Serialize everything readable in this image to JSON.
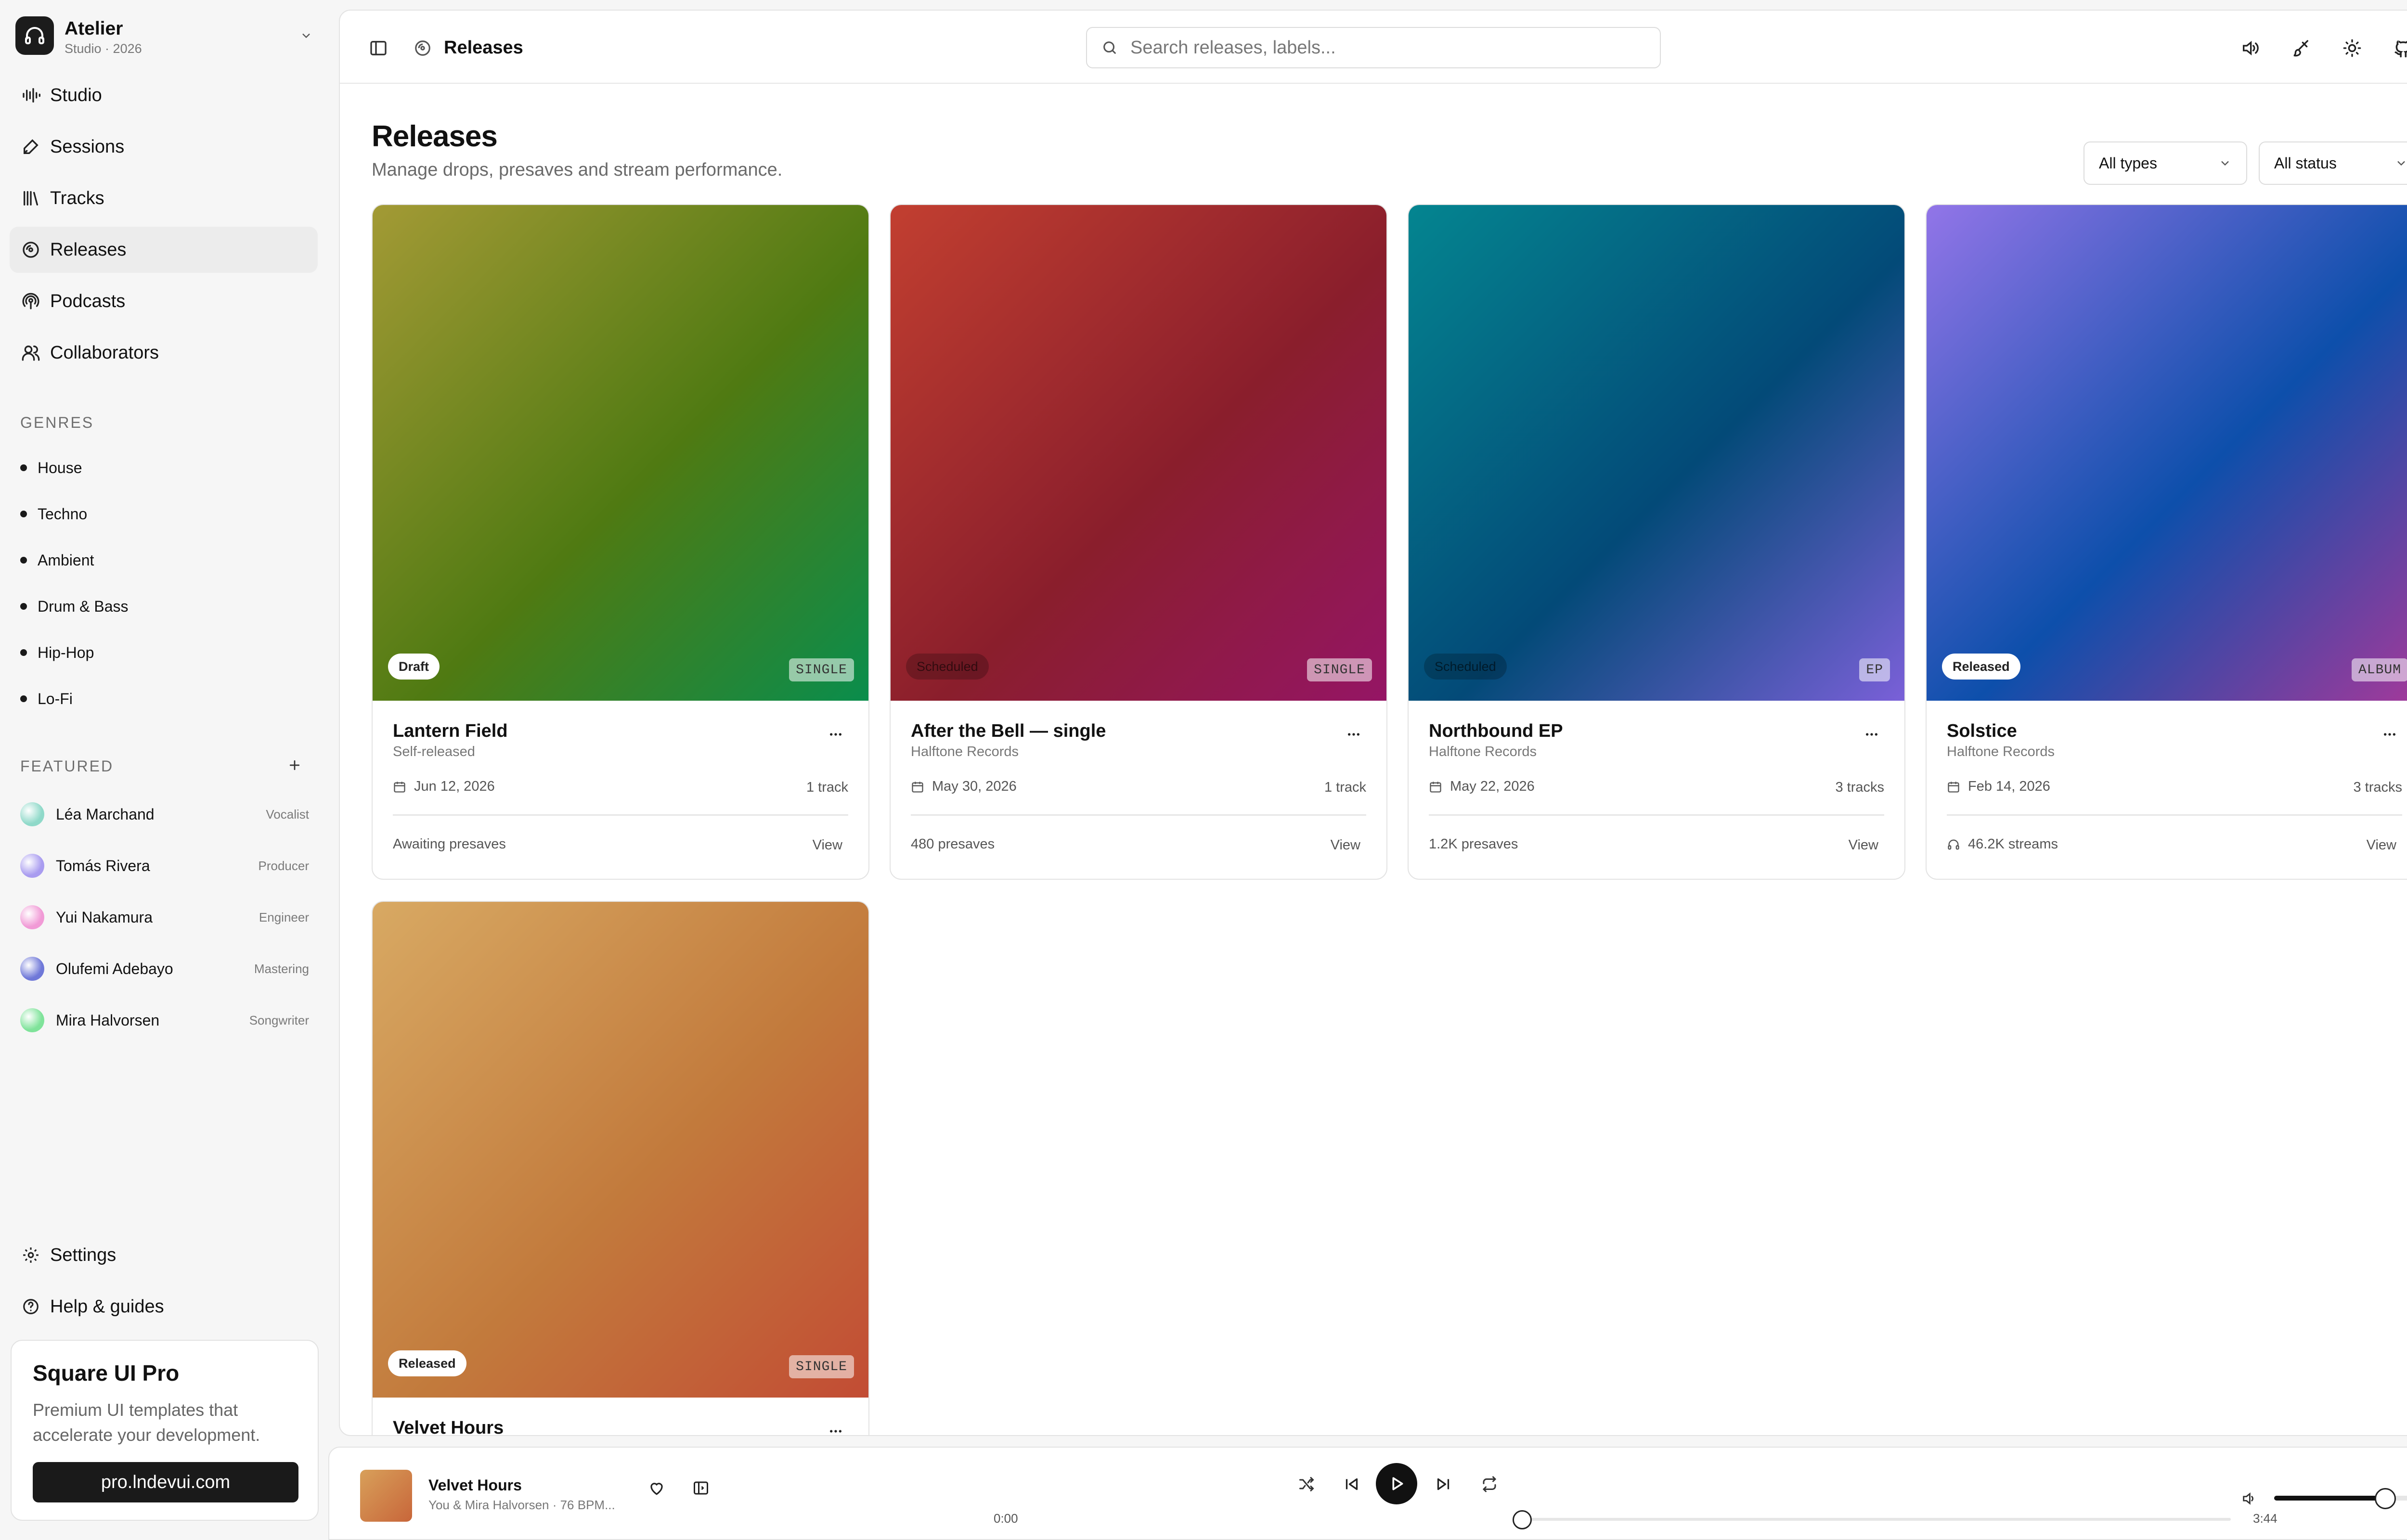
{
  "app": {
    "name": "Atelier",
    "subtitle": "Studio · 2026"
  },
  "nav": [
    {
      "label": "Studio",
      "icon": "waveform-icon"
    },
    {
      "label": "Sessions",
      "icon": "pen-icon"
    },
    {
      "label": "Tracks",
      "icon": "library-icon"
    },
    {
      "label": "Releases",
      "icon": "disc-icon",
      "active": true
    },
    {
      "label": "Podcasts",
      "icon": "podcast-icon"
    },
    {
      "label": "Collaborators",
      "icon": "users-icon"
    }
  ],
  "genres": {
    "title": "GENRES",
    "items": [
      "House",
      "Techno",
      "Ambient",
      "Drum & Bass",
      "Hip-Hop",
      "Lo-Fi"
    ]
  },
  "featured": {
    "title": "FEATURED",
    "people": [
      {
        "name": "Léa Marchand",
        "role": "Vocalist",
        "color": "#8fd9c9"
      },
      {
        "name": "Tomás Rivera",
        "role": "Producer",
        "color": "#a99cf0"
      },
      {
        "name": "Yui Nakamura",
        "role": "Engineer",
        "color": "#f19ad6"
      },
      {
        "name": "Olufemi Adebayo",
        "role": "Mastering",
        "color": "#6f78d8"
      },
      {
        "name": "Mira Halvorsen",
        "role": "Songwriter",
        "color": "#7fe39a"
      }
    ]
  },
  "footer_nav": {
    "settings": "Settings",
    "help": "Help & guides"
  },
  "promo": {
    "title": "Square UI Pro",
    "text": "Premium UI templates that accelerate your development.",
    "button": "pro.lndevui.com"
  },
  "header": {
    "breadcrumb": "Releases",
    "search_placeholder": "Search releases, labels..."
  },
  "page": {
    "title": "Releases",
    "subtitle": "Manage drops, presaves and stream performance.",
    "filter_type": "All types",
    "filter_status": "All status"
  },
  "releases": [
    {
      "title": "Lantern Field",
      "label": "Self-released",
      "status": "Draft",
      "type": "SINGLE",
      "date": "Jun 12, 2026",
      "tracks": "1 track",
      "stat": "Awaiting presaves",
      "view": "View",
      "colors": [
        "#a39a35",
        "#4f7a12",
        "#0a8d4c"
      ]
    },
    {
      "title": "After the Bell — single",
      "label": "Halftone Records",
      "status": "Scheduled",
      "type": "SINGLE",
      "date": "May 30, 2026",
      "tracks": "1 track",
      "stat": "480 presaves",
      "view": "View",
      "colors": [
        "#c23f30",
        "#8a1e2c",
        "#951565"
      ]
    },
    {
      "title": "Northbound EP",
      "label": "Halftone Records",
      "status": "Scheduled",
      "type": "EP",
      "date": "May 22, 2026",
      "tracks": "3 tracks",
      "stat": "1.2K presaves",
      "view": "View",
      "colors": [
        "#048590",
        "#034a78",
        "#7a60d8"
      ]
    },
    {
      "title": "Solstice",
      "label": "Halftone Records",
      "status": "Released",
      "type": "ALBUM",
      "date": "Feb 14, 2026",
      "tracks": "3 tracks",
      "stat": "46.2K  streams",
      "view": "View",
      "colors": [
        "#9275e8",
        "#0d4fab",
        "#a3399a"
      ]
    },
    {
      "title": "Velvet Hours",
      "label": "",
      "status": "Released",
      "type": "SINGLE",
      "date": "",
      "tracks": "",
      "stat": "",
      "view": "",
      "colors": [
        "#d8a963",
        "#c27a3c",
        "#c24c34"
      ]
    }
  ],
  "player": {
    "title": "Velvet Hours",
    "subtitle": "You & Mira Halvorsen · 76 BPM...",
    "elapsed": "0:00",
    "duration": "3:44",
    "progress": 0.0,
    "volume": 0.7
  }
}
